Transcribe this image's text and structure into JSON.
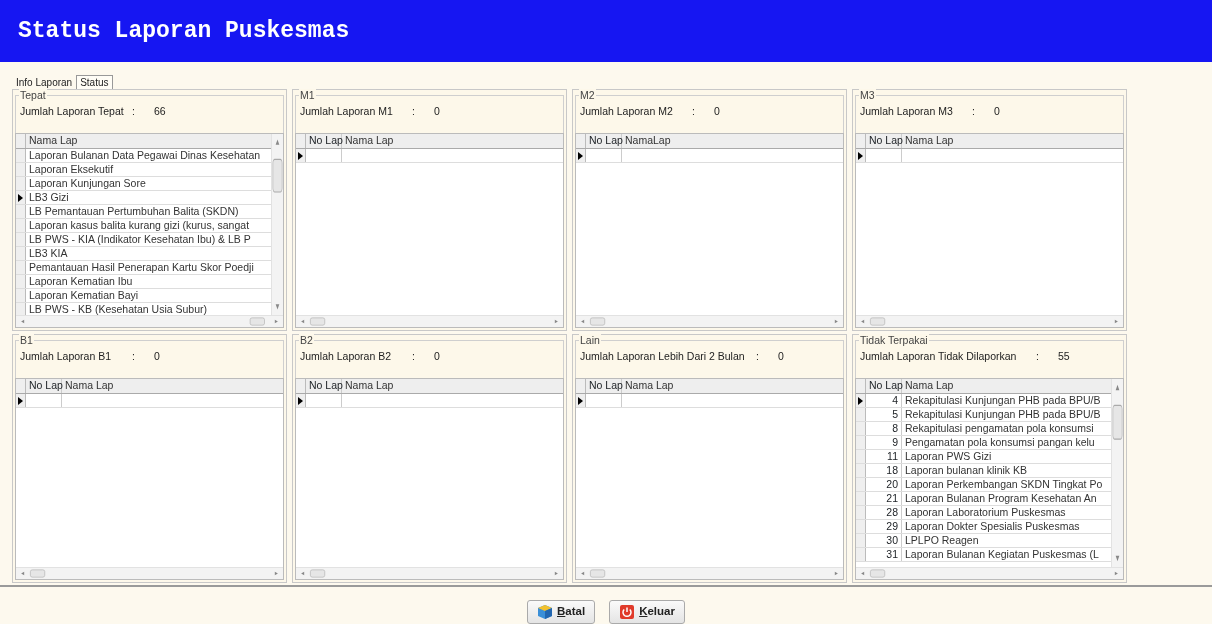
{
  "window": {
    "title": "Status Laporan Puskesmas"
  },
  "tabs": [
    {
      "label": "Info Laporan",
      "selected": false
    },
    {
      "label": "Status",
      "selected": true
    }
  ],
  "panels": [
    {
      "legend": "Tepat",
      "count_label": "Jumlah Laporan Tepat",
      "count_separator": ":",
      "count_value": "66",
      "columns": [
        "Nama Lap"
      ],
      "vertical_scrollbar": true,
      "rows": [
        {
          "name": "Laporan Bulanan Data Pegawai Dinas Kesehatan",
          "selected": false
        },
        {
          "name": "Laporan Eksekutif",
          "selected": false
        },
        {
          "name": "Laporan Kunjungan Sore",
          "selected": false
        },
        {
          "name": "LB3 Gizi",
          "selected": true
        },
        {
          "name": "LB Pemantauan Pertumbuhan Balita (SKDN)",
          "selected": false
        },
        {
          "name": "Laporan kasus balita kurang gizi (kurus, sangat",
          "selected": false
        },
        {
          "name": "LB PWS - KIA (Indikator Kesehatan Ibu) & LB P",
          "selected": false
        },
        {
          "name": "LB3 KIA",
          "selected": false
        },
        {
          "name": "Pemantauan Hasil Penerapan Kartu Skor Poedji",
          "selected": false
        },
        {
          "name": "Laporan Kematian Ibu",
          "selected": false
        },
        {
          "name": "Laporan Kematian Bayi",
          "selected": false
        },
        {
          "name": "LB PWS - KB (Kesehatan Usia Subur)",
          "selected": false
        }
      ]
    },
    {
      "legend": "M1",
      "count_label": "Jumlah Laporan M1",
      "count_separator": ":",
      "count_value": "0",
      "columns": [
        "No Lap",
        "Nama Lap"
      ],
      "vertical_scrollbar": false,
      "rows": [
        {
          "selected": true
        }
      ]
    },
    {
      "legend": "M2",
      "count_label": "Jumlah Laporan M2",
      "count_separator": ":",
      "count_value": "0",
      "columns": [
        "No Lap",
        "NamaLap"
      ],
      "vertical_scrollbar": false,
      "rows": [
        {
          "selected": true
        }
      ]
    },
    {
      "legend": "M3",
      "count_label": "Jumlah Laporan M3",
      "count_separator": ":",
      "count_value": "0",
      "columns": [
        "No Lap",
        "Nama Lap"
      ],
      "vertical_scrollbar": false,
      "rows": [
        {
          "selected": true
        }
      ]
    },
    {
      "legend": "B1",
      "count_label": "Jumlah Laporan B1",
      "count_separator": ":",
      "count_value": "0",
      "columns": [
        "No Lap",
        "Nama Lap"
      ],
      "vertical_scrollbar": false,
      "rows": [
        {
          "selected": true
        }
      ]
    },
    {
      "legend": "B2",
      "count_label": "Jumlah Laporan B2",
      "count_separator": ":",
      "count_value": "0",
      "columns": [
        "No Lap",
        "Nama Lap"
      ],
      "vertical_scrollbar": false,
      "rows": [
        {
          "selected": true
        }
      ]
    },
    {
      "legend": "Lain",
      "count_label": "Jumlah Laporan Lebih Dari 2 Bulan",
      "count_separator": ":",
      "count_value": "0",
      "columns": [
        "No Lap",
        "Nama Lap"
      ],
      "vertical_scrollbar": false,
      "rows": [
        {
          "selected": true
        }
      ]
    },
    {
      "legend": "Tidak Terpakai",
      "count_label": "Jumlah Laporan Tidak Dilaporkan",
      "count_separator": ":",
      "count_value": "55",
      "columns": [
        "No Lap",
        "Nama Lap"
      ],
      "vertical_scrollbar": true,
      "rows": [
        {
          "no": "4",
          "name": "Rekapitulasi Kunjungan PHB pada BPU/B",
          "selected": true
        },
        {
          "no": "5",
          "name": "Rekapitulasi Kunjungan PHB pada BPU/B",
          "selected": false
        },
        {
          "no": "8",
          "name": "Rekapitulasi pengamatan pola konsumsi",
          "selected": false
        },
        {
          "no": "9",
          "name": "Pengamatan pola konsumsi pangan kelu",
          "selected": false
        },
        {
          "no": "11",
          "name": "Laporan PWS Gizi",
          "selected": false
        },
        {
          "no": "18",
          "name": "Laporan bulanan klinik KB",
          "selected": false
        },
        {
          "no": "20",
          "name": "Laporan Perkembangan SKDN Tingkat Po",
          "selected": false
        },
        {
          "no": "21",
          "name": "Laporan Bulanan Program Kesehatan An",
          "selected": false
        },
        {
          "no": "28",
          "name": "Laporan Laboratorium Puskesmas",
          "selected": false
        },
        {
          "no": "29",
          "name": "Laporan Dokter Spesialis Puskesmas",
          "selected": false
        },
        {
          "no": "30",
          "name": "LPLPO Reagen",
          "selected": false
        },
        {
          "no": "31",
          "name": "Laporan Bulanan Kegiatan Puskesmas (L",
          "selected": false
        }
      ]
    }
  ],
  "buttons": [
    {
      "label": "Batal",
      "kind": "cancel"
    },
    {
      "label": "Keluar",
      "kind": "exit"
    }
  ]
}
